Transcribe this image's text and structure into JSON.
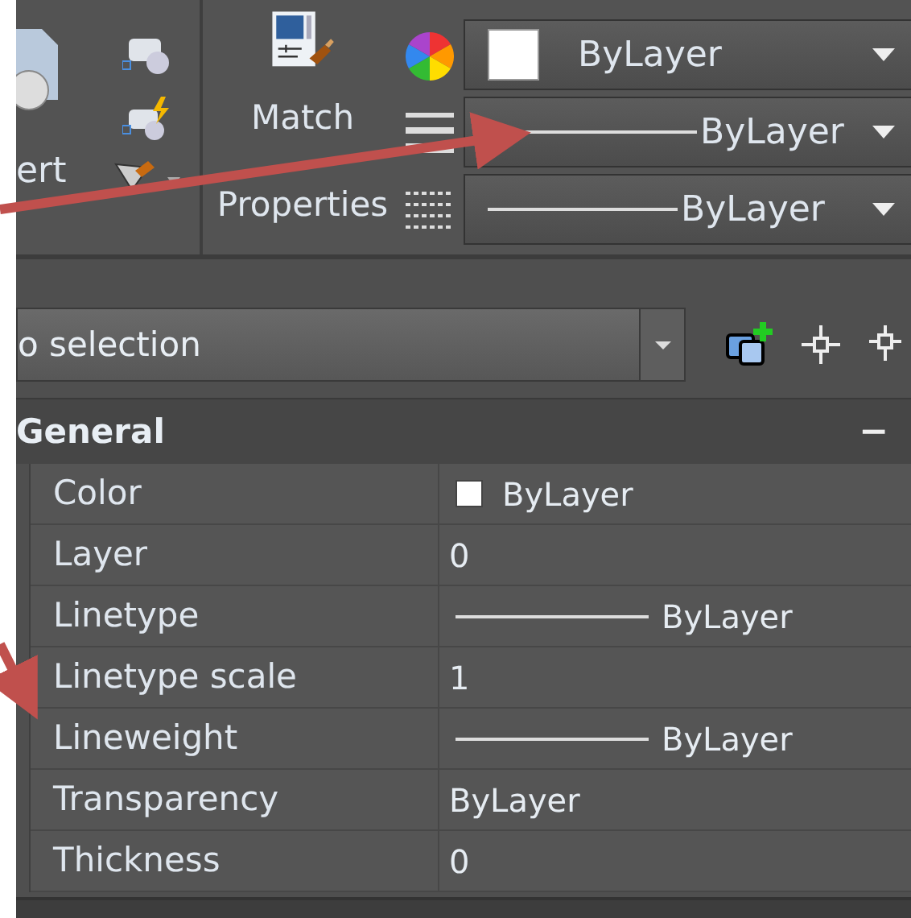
{
  "ribbon": {
    "insert_label": "ert",
    "match_label": "Match Properties",
    "dropdowns": [
      {
        "kind": "color",
        "value": "ByLayer"
      },
      {
        "kind": "line",
        "value": "ByLayer"
      },
      {
        "kind": "line",
        "value": "ByLayer"
      }
    ]
  },
  "selection": {
    "value": "o selection"
  },
  "section": {
    "title": "General",
    "toggle": "−"
  },
  "properties": [
    {
      "name": "Color",
      "kind": "swatch",
      "value": "ByLayer"
    },
    {
      "name": "Layer",
      "kind": "text",
      "value": "0"
    },
    {
      "name": "Linetype",
      "kind": "line",
      "value": "ByLayer"
    },
    {
      "name": "Linetype scale",
      "kind": "text",
      "value": "1"
    },
    {
      "name": "Lineweight",
      "kind": "line",
      "value": "ByLayer"
    },
    {
      "name": "Transparency",
      "kind": "text",
      "value": "ByLayer"
    },
    {
      "name": "Thickness",
      "kind": "text",
      "value": "0"
    }
  ]
}
